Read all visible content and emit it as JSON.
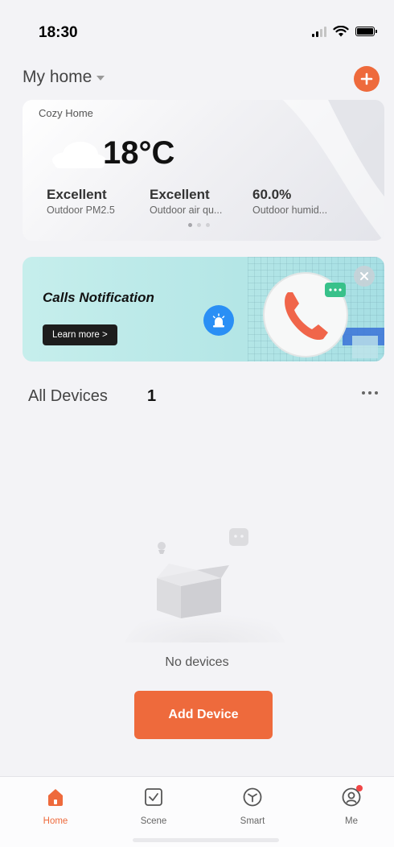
{
  "status_bar": {
    "time": "18:30"
  },
  "header": {
    "home_name": "My home"
  },
  "weather": {
    "home_label": "Cozy Home",
    "temperature": "18°C",
    "metrics": [
      {
        "value": "Excellent",
        "label": "Outdoor PM2.5"
      },
      {
        "value": "Excellent",
        "label": "Outdoor air qu..."
      },
      {
        "value": "60.0%",
        "label": "Outdoor humid..."
      }
    ],
    "page_count": 3,
    "active_page": 1
  },
  "banner": {
    "title": "Calls Notification",
    "button_label": "Learn more >"
  },
  "devices": {
    "title": "All Devices",
    "count": "1",
    "empty_text": "No devices",
    "add_button_label": "Add Device"
  },
  "tabs": [
    {
      "label": "Home",
      "icon": "home-icon",
      "active": true
    },
    {
      "label": "Scene",
      "icon": "scene-check-icon",
      "active": false
    },
    {
      "label": "Smart",
      "icon": "smart-cube-icon",
      "active": false
    },
    {
      "label": "Me",
      "icon": "user-profile-icon",
      "active": false,
      "has_notification_dot": true
    }
  ],
  "colors": {
    "accent": "#ee6a3c",
    "background": "#f3f3f6",
    "banner_bg": "#b4e6e6",
    "notification_dot": "#f04646"
  }
}
